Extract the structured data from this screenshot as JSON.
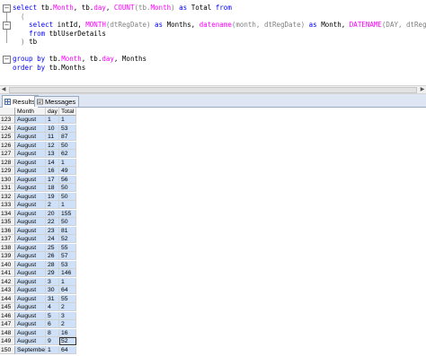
{
  "editor": {
    "lines": [
      [
        {
          "t": "select ",
          "c": "kw"
        },
        {
          "t": "tb.",
          "c": ""
        },
        {
          "t": "Month",
          "c": "fn"
        },
        {
          "t": ", tb.",
          "c": ""
        },
        {
          "t": "day",
          "c": "fn"
        },
        {
          "t": ", ",
          "c": ""
        },
        {
          "t": "COUNT",
          "c": "fn"
        },
        {
          "t": "(tb.",
          "c": "gr"
        },
        {
          "t": "Month",
          "c": "fn"
        },
        {
          "t": ") ",
          "c": "gr"
        },
        {
          "t": "as ",
          "c": "kw"
        },
        {
          "t": "Total ",
          "c": ""
        },
        {
          "t": "from",
          "c": "kw"
        }
      ],
      [
        {
          "t": "  (",
          "c": "gr"
        }
      ],
      [
        {
          "t": "    select ",
          "c": "kw"
        },
        {
          "t": "intId, ",
          "c": ""
        },
        {
          "t": "MONTH",
          "c": "fn"
        },
        {
          "t": "(dtRegDate) ",
          "c": "gr"
        },
        {
          "t": "as ",
          "c": "kw"
        },
        {
          "t": "Months, ",
          "c": ""
        },
        {
          "t": "datename",
          "c": "fn"
        },
        {
          "t": "(month, dtRegDate) ",
          "c": "gr"
        },
        {
          "t": "as ",
          "c": "kw"
        },
        {
          "t": "Month, ",
          "c": ""
        },
        {
          "t": "DATENAME",
          "c": "fn"
        },
        {
          "t": "(DAY, dtRegDate) ",
          "c": "gr"
        },
        {
          "t": "as ",
          "c": "kw"
        },
        {
          "t": "day",
          "c": ""
        }
      ],
      [
        {
          "t": "    from ",
          "c": "kw"
        },
        {
          "t": "tblUserDetails",
          "c": ""
        }
      ],
      [
        {
          "t": "  ) ",
          "c": "gr"
        },
        {
          "t": "tb",
          "c": ""
        }
      ],
      [
        {
          "t": "",
          "c": ""
        }
      ],
      [
        {
          "t": "group by ",
          "c": "kw"
        },
        {
          "t": "tb.",
          "c": ""
        },
        {
          "t": "Month",
          "c": "fn"
        },
        {
          "t": ", tb.",
          "c": ""
        },
        {
          "t": "day",
          "c": "fn"
        },
        {
          "t": ", Months",
          "c": ""
        }
      ],
      [
        {
          "t": "order by ",
          "c": "kw"
        },
        {
          "t": "tb.Months",
          "c": ""
        }
      ]
    ]
  },
  "tabs": [
    {
      "label": "Results",
      "icon": "grid-icon",
      "active": true
    },
    {
      "label": "Messages",
      "icon": "message-icon",
      "active": false
    }
  ],
  "grid": {
    "columns": [
      "Month",
      "day",
      "Total"
    ],
    "rows": [
      [
        "123",
        "August",
        "1",
        "1"
      ],
      [
        "124",
        "August",
        "10",
        "53"
      ],
      [
        "125",
        "August",
        "11",
        "87"
      ],
      [
        "126",
        "August",
        "12",
        "50"
      ],
      [
        "127",
        "August",
        "13",
        "62"
      ],
      [
        "128",
        "August",
        "14",
        "1"
      ],
      [
        "129",
        "August",
        "16",
        "49"
      ],
      [
        "130",
        "August",
        "17",
        "56"
      ],
      [
        "131",
        "August",
        "18",
        "50"
      ],
      [
        "132",
        "August",
        "19",
        "50"
      ],
      [
        "133",
        "August",
        "2",
        "1"
      ],
      [
        "134",
        "August",
        "20",
        "155"
      ],
      [
        "135",
        "August",
        "22",
        "50"
      ],
      [
        "136",
        "August",
        "23",
        "81"
      ],
      [
        "137",
        "August",
        "24",
        "52"
      ],
      [
        "138",
        "August",
        "25",
        "55"
      ],
      [
        "139",
        "August",
        "26",
        "57"
      ],
      [
        "140",
        "August",
        "28",
        "53"
      ],
      [
        "141",
        "August",
        "29",
        "146"
      ],
      [
        "142",
        "August",
        "3",
        "1"
      ],
      [
        "143",
        "August",
        "30",
        "64"
      ],
      [
        "144",
        "August",
        "31",
        "55"
      ],
      [
        "145",
        "August",
        "4",
        "2"
      ],
      [
        "146",
        "August",
        "5",
        "3"
      ],
      [
        "147",
        "August",
        "6",
        "2"
      ],
      [
        "148",
        "August",
        "8",
        "16"
      ],
      [
        "149",
        "August",
        "9",
        "52"
      ],
      [
        "150",
        "September",
        "1",
        "64"
      ]
    ]
  },
  "colors": {
    "keyword": "#0000ff",
    "function": "#ff00ff",
    "punctuation": "#808080",
    "selection": "#cfe1f8"
  }
}
